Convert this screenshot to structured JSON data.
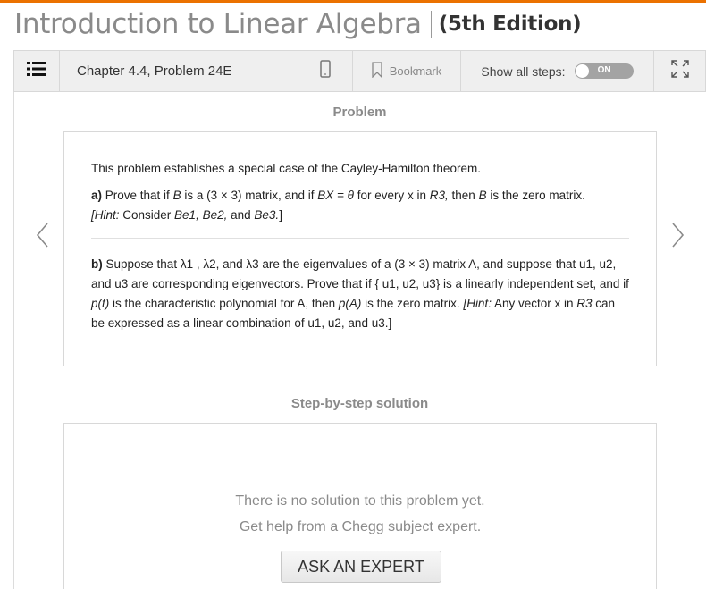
{
  "book": {
    "title": "Introduction to Linear Algebra",
    "edition": "(5th Edition)"
  },
  "colors": {
    "accent": "#eb7100",
    "toolbar_bg": "#efefef",
    "muted_text": "#8a8a8a"
  },
  "toolbar": {
    "list_icon": "list-icon",
    "chapter_label": "Chapter 4.4, Problem 24E",
    "mobile_icon": "mobile-icon",
    "bookmark_label": "Bookmark",
    "bookmark_icon": "bookmark-icon",
    "show_steps_label": "Show all steps:",
    "toggle_label": "ON",
    "expand_icon": "expand-icon"
  },
  "problem": {
    "heading": "Problem",
    "intro": "This problem establishes a special case of the Cayley-Hamilton theorem.",
    "part_a": {
      "label": "a)",
      "t1": " Prove that if ",
      "B1": "B",
      "t2": " is a (3 × 3) matrix, and if ",
      "BX": "BX = θ",
      "t3": " for every x in ",
      "R3": "R3,",
      "t4": " then ",
      "B2": "B",
      "t5": " is the zero matrix.",
      "hint_open": "[Hint:",
      "hint_t1": " Consider ",
      "Be1": "Be1,",
      "hint_sp1": " ",
      "Be2": "Be2,",
      "hint_and": " and ",
      "Be3": "Be3.",
      "hint_close": "]"
    },
    "part_b": {
      "label": "b)",
      "t1": " Suppose that λ1 , λ2, and λ3 are the eigenvalues of a (3 × 3) matrix A, and suppose that u1, u2, and u3 are corresponding eigenvectors. Prove that if { u1, u2, u3} is a linearly independent set, and if ",
      "pt": "p(t)",
      "t2": " is the characteristic polynomial for A, then ",
      "pA": "p(A)",
      "t3": " is the zero matrix. ",
      "hint_open": "[Hint:",
      "t4": " Any vector x in ",
      "R3": "R3",
      "t5": " can be expressed as a linear combination of u1, u2, and u3.]"
    }
  },
  "nav": {
    "prev_icon": "chevron-left-icon",
    "next_icon": "chevron-right-icon"
  },
  "solution": {
    "heading": "Step-by-step solution",
    "no_solution": "There is no solution to this problem yet.",
    "help_text": "Get help from a Chegg subject expert.",
    "button_label": "ASK AN EXPERT"
  }
}
